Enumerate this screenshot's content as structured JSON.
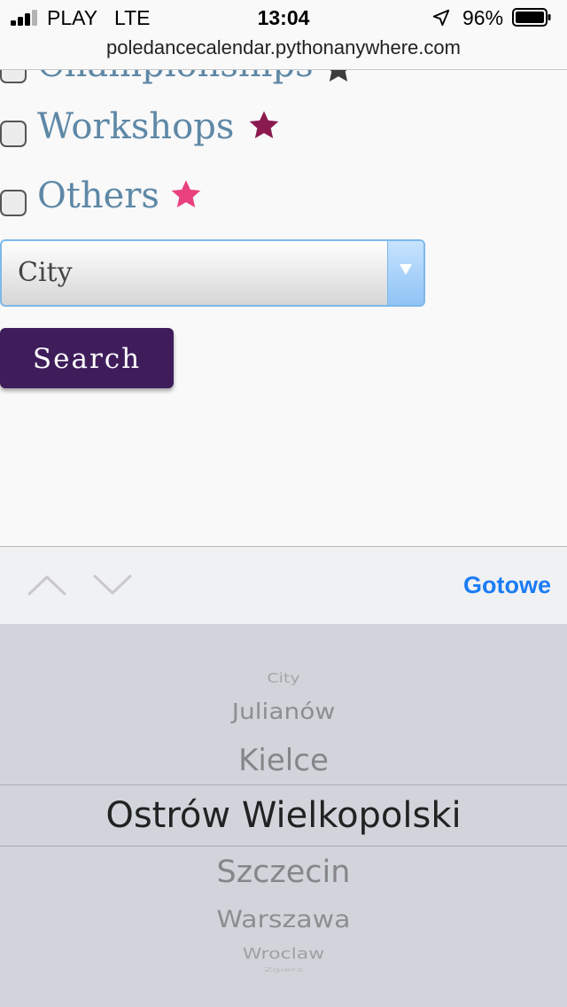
{
  "status_bar": {
    "carrier": "PLAY",
    "network": "LTE",
    "time": "13:04",
    "battery": "96%"
  },
  "browser": {
    "url": "poledancecalendar.pythonanywhere.com"
  },
  "filters": {
    "categories": [
      {
        "label": "Championships",
        "star_color": "#3d3d3d",
        "checked": false
      },
      {
        "label": "Workshops",
        "star_color": "#8b1a4f",
        "checked": false
      },
      {
        "label": "Others",
        "star_color": "#e8417e",
        "checked": false
      }
    ],
    "city_select": {
      "value": "City"
    },
    "search_label": "Search"
  },
  "keyboard_toolbar": {
    "prev_icon": "chevron-up-icon",
    "next_icon": "chevron-down-icon",
    "done_label": "Gotowe"
  },
  "picker": {
    "options": [
      "City",
      "Julianów",
      "Kielce",
      "Ostrów Wielkopolski",
      "Szczecin",
      "Warszawa",
      "Wroclaw",
      "Zgierz"
    ],
    "selected": "Ostrów Wielkopolski"
  },
  "colors": {
    "label_blue": "#5e88a6",
    "button_purple": "#3f1d5b",
    "select_border": "#7db8ea",
    "ios_blue": "#1a7cf5"
  }
}
